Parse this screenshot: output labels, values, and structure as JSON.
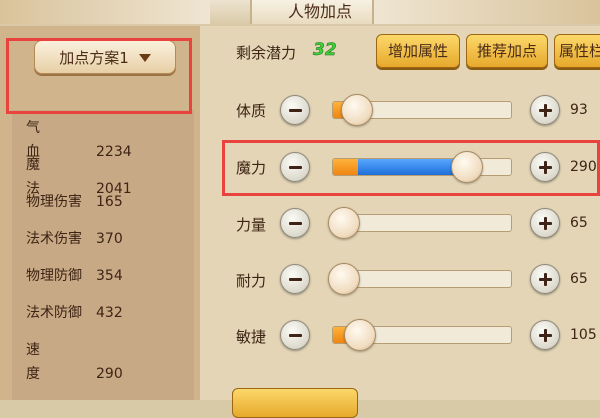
{
  "window": {
    "title": "人物加点"
  },
  "left_panel": {
    "scheme_dropdown": {
      "label": "加点方案1",
      "icon": "chevron-down-icon"
    },
    "stats": [
      {
        "name": "气血",
        "value": "2234"
      },
      {
        "name": "魔法",
        "value": "2041"
      },
      {
        "name": "物理伤害",
        "value": "165"
      },
      {
        "name": "法术伤害",
        "value": "370"
      },
      {
        "name": "物理防御",
        "value": "354"
      },
      {
        "name": "法术防御",
        "value": "432"
      },
      {
        "name": "速度",
        "value": "290"
      }
    ]
  },
  "right_panel": {
    "potential_label": "剩余潜力",
    "potential_value": "32",
    "buttons": {
      "add_attr": "增加属性",
      "recommend": "推荐加点",
      "attr_more": "属性栏"
    },
    "attributes": [
      {
        "name": "体质",
        "value": "93",
        "base_fraction": 0.14,
        "added_fraction": 0.0
      },
      {
        "name": "魔力",
        "value": "290",
        "base_fraction": 0.14,
        "added_fraction": 0.62
      },
      {
        "name": "力量",
        "value": "65",
        "base_fraction": 0.07,
        "added_fraction": 0.0
      },
      {
        "name": "耐力",
        "value": "65",
        "base_fraction": 0.07,
        "added_fraction": 0.0
      },
      {
        "name": "敏捷",
        "value": "105",
        "base_fraction": 0.16,
        "added_fraction": 0.0
      }
    ]
  },
  "colors": {
    "highlight": "#e8433d",
    "base_fill": "#ef8512",
    "added_fill": "#1d6fd8",
    "potential": "#3fcf3a"
  }
}
